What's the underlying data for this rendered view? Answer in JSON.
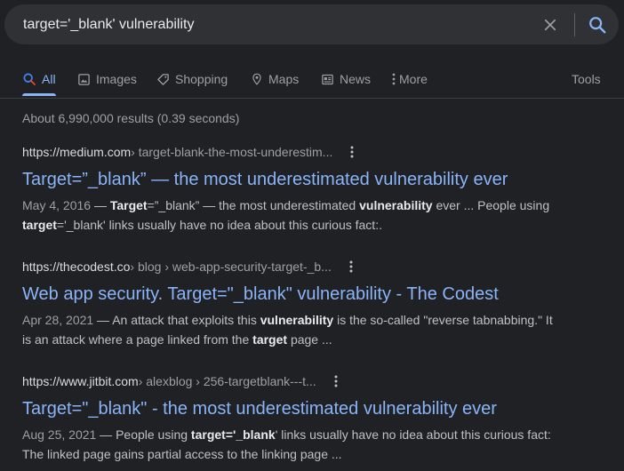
{
  "search": {
    "query": "target='_blank' vulnerability"
  },
  "tabs": [
    {
      "label": "All",
      "icon": "search-icon",
      "active": true
    },
    {
      "label": "Images",
      "icon": "image-icon"
    },
    {
      "label": "Shopping",
      "icon": "tag-icon"
    },
    {
      "label": "Maps",
      "icon": "map-pin-icon"
    },
    {
      "label": "News",
      "icon": "newspaper-icon"
    },
    {
      "label": "More",
      "icon": "more-vert-icon"
    }
  ],
  "tools_label": "Tools",
  "stats": "About 6,990,000 results (0.39 seconds)",
  "results": [
    {
      "domain": "https://medium.com",
      "path": " › target-blank-the-most-underestim...",
      "title": "Target=”_blank” — the most underestimated vulnerability ever",
      "date": "May 4, 2016",
      "snippet_parts": [
        {
          "t": "",
          "b": false
        },
        {
          "t": "Target",
          "b": true
        },
        {
          "t": "=”_blank” — the most underestimated ",
          "b": false
        },
        {
          "t": "vulnerability",
          "b": true
        },
        {
          "t": " ever ... People using ",
          "b": false
        },
        {
          "t": "target",
          "b": true
        },
        {
          "t": "='_blank' links usually have no idea about this curious fact:.",
          "b": false
        }
      ]
    },
    {
      "domain": "https://thecodest.co",
      "path": " › blog › web-app-security-target-_b...",
      "title": "Web app security. Target=\"_blank\" vulnerability - The Codest",
      "date": "Apr 28, 2021",
      "snippet_parts": [
        {
          "t": "An attack that exploits this ",
          "b": false
        },
        {
          "t": "vulnerability",
          "b": true
        },
        {
          "t": " is the so-called \"reverse tabnabbing.\" It is an attack where a page linked from the ",
          "b": false
        },
        {
          "t": "target",
          "b": true
        },
        {
          "t": " page ...",
          "b": false
        }
      ]
    },
    {
      "domain": "https://www.jitbit.com",
      "path": " › alexblog › 256-targetblank---t...",
      "title": "Target=\"_blank\" - the most underestimated vulnerability ever",
      "date": "Aug 25, 2021",
      "snippet_parts": [
        {
          "t": "People using ",
          "b": false
        },
        {
          "t": "target='_blank",
          "b": true
        },
        {
          "t": "' links usually have no idea about this curious fact: The linked page gains partial access to the linking page ...",
          "b": false
        }
      ]
    }
  ],
  "colors": {
    "background": "#202124",
    "search_bar": "#303134",
    "link": "#8ab4f8",
    "muted": "#9aa0a6"
  }
}
